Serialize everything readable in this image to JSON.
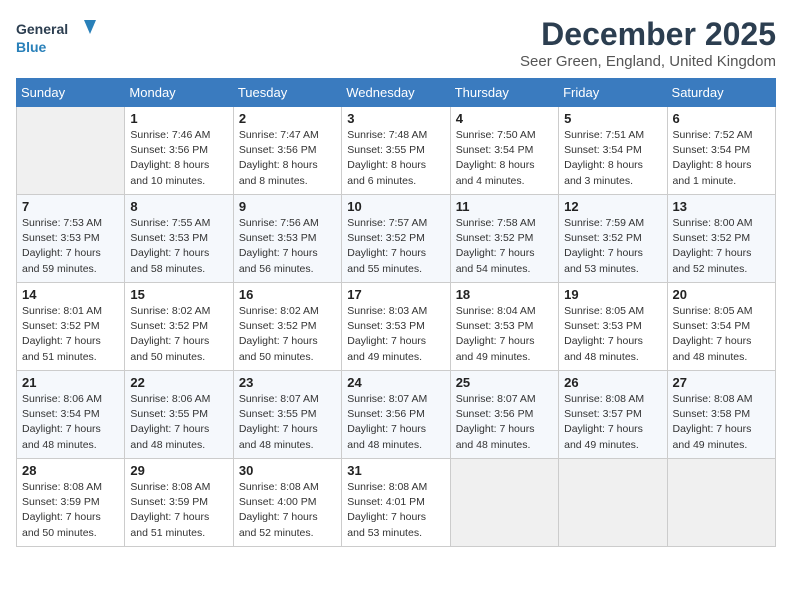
{
  "header": {
    "logo_line1": "General",
    "logo_line2": "Blue",
    "month": "December 2025",
    "location": "Seer Green, England, United Kingdom"
  },
  "days_of_week": [
    "Sunday",
    "Monday",
    "Tuesday",
    "Wednesday",
    "Thursday",
    "Friday",
    "Saturday"
  ],
  "weeks": [
    [
      {
        "date": "",
        "info": ""
      },
      {
        "date": "1",
        "info": "Sunrise: 7:46 AM\nSunset: 3:56 PM\nDaylight: 8 hours\nand 10 minutes."
      },
      {
        "date": "2",
        "info": "Sunrise: 7:47 AM\nSunset: 3:56 PM\nDaylight: 8 hours\nand 8 minutes."
      },
      {
        "date": "3",
        "info": "Sunrise: 7:48 AM\nSunset: 3:55 PM\nDaylight: 8 hours\nand 6 minutes."
      },
      {
        "date": "4",
        "info": "Sunrise: 7:50 AM\nSunset: 3:54 PM\nDaylight: 8 hours\nand 4 minutes."
      },
      {
        "date": "5",
        "info": "Sunrise: 7:51 AM\nSunset: 3:54 PM\nDaylight: 8 hours\nand 3 minutes."
      },
      {
        "date": "6",
        "info": "Sunrise: 7:52 AM\nSunset: 3:54 PM\nDaylight: 8 hours\nand 1 minute."
      }
    ],
    [
      {
        "date": "7",
        "info": "Sunrise: 7:53 AM\nSunset: 3:53 PM\nDaylight: 7 hours\nand 59 minutes."
      },
      {
        "date": "8",
        "info": "Sunrise: 7:55 AM\nSunset: 3:53 PM\nDaylight: 7 hours\nand 58 minutes."
      },
      {
        "date": "9",
        "info": "Sunrise: 7:56 AM\nSunset: 3:53 PM\nDaylight: 7 hours\nand 56 minutes."
      },
      {
        "date": "10",
        "info": "Sunrise: 7:57 AM\nSunset: 3:52 PM\nDaylight: 7 hours\nand 55 minutes."
      },
      {
        "date": "11",
        "info": "Sunrise: 7:58 AM\nSunset: 3:52 PM\nDaylight: 7 hours\nand 54 minutes."
      },
      {
        "date": "12",
        "info": "Sunrise: 7:59 AM\nSunset: 3:52 PM\nDaylight: 7 hours\nand 53 minutes."
      },
      {
        "date": "13",
        "info": "Sunrise: 8:00 AM\nSunset: 3:52 PM\nDaylight: 7 hours\nand 52 minutes."
      }
    ],
    [
      {
        "date": "14",
        "info": "Sunrise: 8:01 AM\nSunset: 3:52 PM\nDaylight: 7 hours\nand 51 minutes."
      },
      {
        "date": "15",
        "info": "Sunrise: 8:02 AM\nSunset: 3:52 PM\nDaylight: 7 hours\nand 50 minutes."
      },
      {
        "date": "16",
        "info": "Sunrise: 8:02 AM\nSunset: 3:52 PM\nDaylight: 7 hours\nand 50 minutes."
      },
      {
        "date": "17",
        "info": "Sunrise: 8:03 AM\nSunset: 3:53 PM\nDaylight: 7 hours\nand 49 minutes."
      },
      {
        "date": "18",
        "info": "Sunrise: 8:04 AM\nSunset: 3:53 PM\nDaylight: 7 hours\nand 49 minutes."
      },
      {
        "date": "19",
        "info": "Sunrise: 8:05 AM\nSunset: 3:53 PM\nDaylight: 7 hours\nand 48 minutes."
      },
      {
        "date": "20",
        "info": "Sunrise: 8:05 AM\nSunset: 3:54 PM\nDaylight: 7 hours\nand 48 minutes."
      }
    ],
    [
      {
        "date": "21",
        "info": "Sunrise: 8:06 AM\nSunset: 3:54 PM\nDaylight: 7 hours\nand 48 minutes."
      },
      {
        "date": "22",
        "info": "Sunrise: 8:06 AM\nSunset: 3:55 PM\nDaylight: 7 hours\nand 48 minutes."
      },
      {
        "date": "23",
        "info": "Sunrise: 8:07 AM\nSunset: 3:55 PM\nDaylight: 7 hours\nand 48 minutes."
      },
      {
        "date": "24",
        "info": "Sunrise: 8:07 AM\nSunset: 3:56 PM\nDaylight: 7 hours\nand 48 minutes."
      },
      {
        "date": "25",
        "info": "Sunrise: 8:07 AM\nSunset: 3:56 PM\nDaylight: 7 hours\nand 48 minutes."
      },
      {
        "date": "26",
        "info": "Sunrise: 8:08 AM\nSunset: 3:57 PM\nDaylight: 7 hours\nand 49 minutes."
      },
      {
        "date": "27",
        "info": "Sunrise: 8:08 AM\nSunset: 3:58 PM\nDaylight: 7 hours\nand 49 minutes."
      }
    ],
    [
      {
        "date": "28",
        "info": "Sunrise: 8:08 AM\nSunset: 3:59 PM\nDaylight: 7 hours\nand 50 minutes."
      },
      {
        "date": "29",
        "info": "Sunrise: 8:08 AM\nSunset: 3:59 PM\nDaylight: 7 hours\nand 51 minutes."
      },
      {
        "date": "30",
        "info": "Sunrise: 8:08 AM\nSunset: 4:00 PM\nDaylight: 7 hours\nand 52 minutes."
      },
      {
        "date": "31",
        "info": "Sunrise: 8:08 AM\nSunset: 4:01 PM\nDaylight: 7 hours\nand 53 minutes."
      },
      {
        "date": "",
        "info": ""
      },
      {
        "date": "",
        "info": ""
      },
      {
        "date": "",
        "info": ""
      }
    ]
  ]
}
